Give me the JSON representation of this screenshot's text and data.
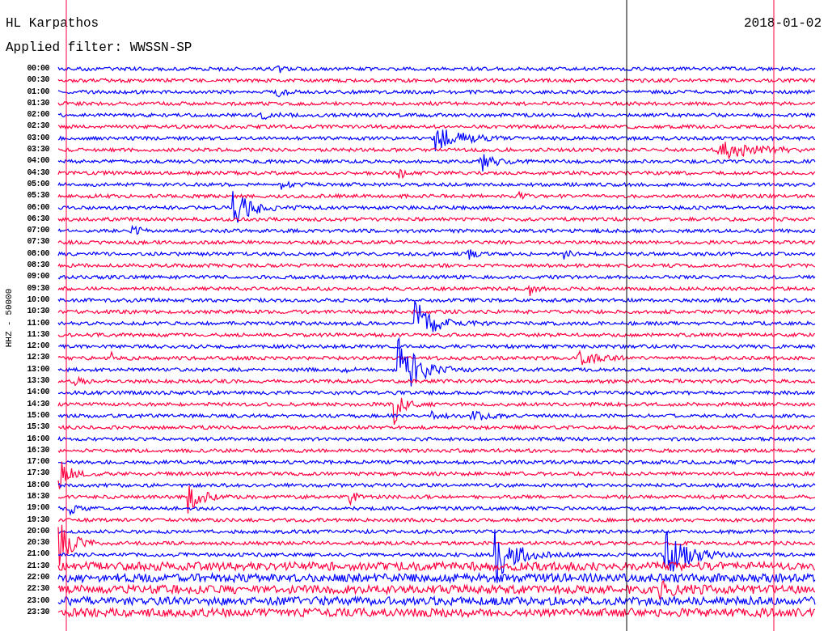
{
  "station": "HL Karpathos",
  "date": "2018-01-02",
  "filter": "Applied filter: WWSSN-SP",
  "channel_label": "HHZ - 50000",
  "traces": [
    {
      "time": "00:00",
      "color": "#0000ff"
    },
    {
      "time": "00:30",
      "color": "#ff0040"
    },
    {
      "time": "01:00",
      "color": "#0000ff"
    },
    {
      "time": "01:30",
      "color": "#ff0040"
    },
    {
      "time": "02:00",
      "color": "#0000ff"
    },
    {
      "time": "02:30",
      "color": "#ff0040"
    },
    {
      "time": "03:00",
      "color": "#0000ff"
    },
    {
      "time": "03:30",
      "color": "#ff0040"
    },
    {
      "time": "04:00",
      "color": "#0000ff"
    },
    {
      "time": "04:30",
      "color": "#ff0040"
    },
    {
      "time": "05:00",
      "color": "#0000ff"
    },
    {
      "time": "05:30",
      "color": "#ff0040"
    },
    {
      "time": "06:00",
      "color": "#0000ff"
    },
    {
      "time": "06:30",
      "color": "#ff0040"
    },
    {
      "time": "07:00",
      "color": "#0000ff"
    },
    {
      "time": "07:30",
      "color": "#ff0040"
    },
    {
      "time": "08:00",
      "color": "#0000ff"
    },
    {
      "time": "08:30",
      "color": "#ff0040"
    },
    {
      "time": "09:00",
      "color": "#0000ff"
    },
    {
      "time": "09:30",
      "color": "#ff0040"
    },
    {
      "time": "10:00",
      "color": "#0000ff"
    },
    {
      "time": "10:30",
      "color": "#ff0040"
    },
    {
      "time": "11:00",
      "color": "#0000ff"
    },
    {
      "time": "11:30",
      "color": "#ff0040"
    },
    {
      "time": "12:00",
      "color": "#0000ff"
    },
    {
      "time": "12:30",
      "color": "#ff0040"
    },
    {
      "time": "13:00",
      "color": "#0000ff"
    },
    {
      "time": "13:30",
      "color": "#ff0040"
    },
    {
      "time": "14:00",
      "color": "#0000ff"
    },
    {
      "time": "14:30",
      "color": "#ff0040"
    },
    {
      "time": "15:00",
      "color": "#0000ff"
    },
    {
      "time": "15:30",
      "color": "#ff0040"
    },
    {
      "time": "16:00",
      "color": "#0000ff"
    },
    {
      "time": "16:30",
      "color": "#ff0040"
    },
    {
      "time": "17:00",
      "color": "#0000ff"
    },
    {
      "time": "17:30",
      "color": "#ff0040"
    },
    {
      "time": "18:00",
      "color": "#0000ff"
    },
    {
      "time": "18:30",
      "color": "#ff0040"
    },
    {
      "time": "19:00",
      "color": "#0000ff"
    },
    {
      "time": "19:30",
      "color": "#ff0040"
    },
    {
      "time": "20:00",
      "color": "#0000ff"
    },
    {
      "time": "20:30",
      "color": "#ff0040"
    },
    {
      "time": "21:00",
      "color": "#0000ff"
    },
    {
      "time": "21:30",
      "color": "#ff0040"
    },
    {
      "time": "22:00",
      "color": "#0000ff"
    },
    {
      "time": "22:30",
      "color": "#ff0040"
    },
    {
      "time": "23:00",
      "color": "#0000ff"
    },
    {
      "time": "23:30",
      "color": "#ff0040"
    }
  ]
}
